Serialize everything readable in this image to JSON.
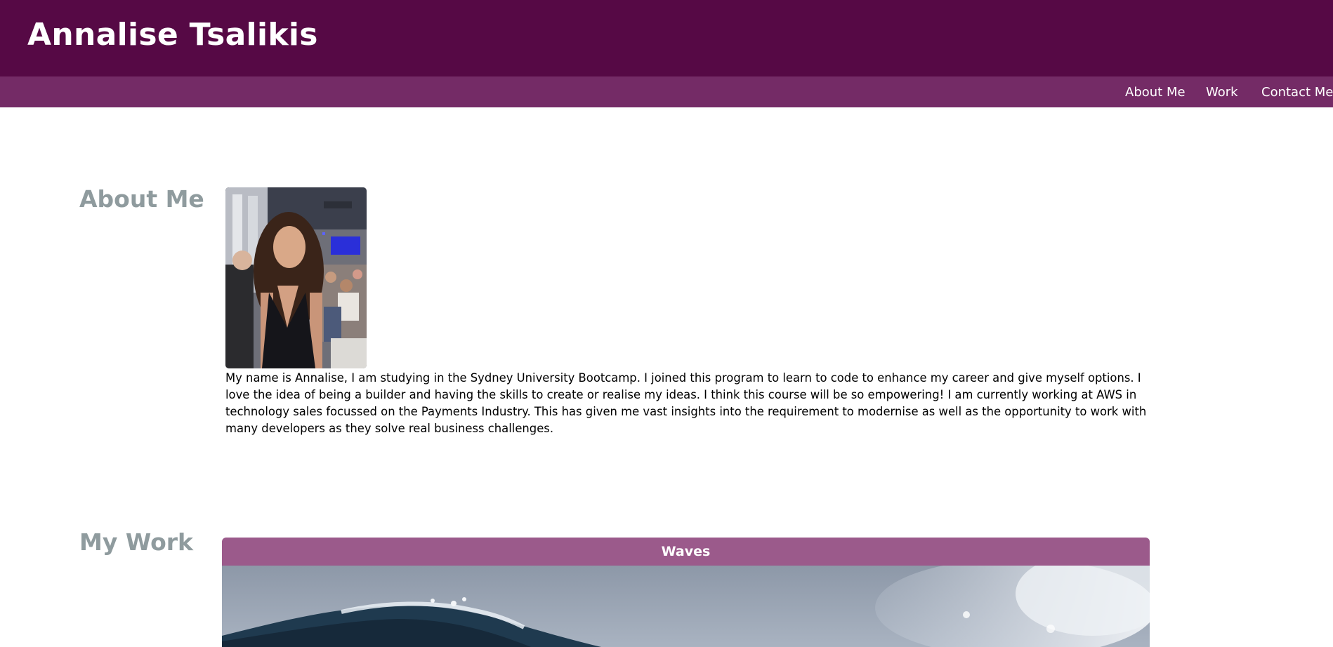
{
  "header": {
    "title": "Annalise Tsalikis"
  },
  "nav": {
    "items": [
      {
        "label": "About Me"
      },
      {
        "label": "Work"
      },
      {
        "label": "Contact Me"
      }
    ]
  },
  "about": {
    "heading": "About Me",
    "bio": "My name is Annalise, I am studying in the Sydney University Bootcamp. I joined this program to learn to code to enhance my career and give myself options. I love the idea of being a builder and having the skills to create or realise my ideas. I think this course will be so empowering! I am currently working at AWS in technology sales focussed on the Payments Industry. This has given me vast insights into the requirement to modernise as well as the opportunity to work with many developers as they solve real business challenges."
  },
  "work": {
    "heading": "My Work",
    "projects": [
      {
        "title": "Waves"
      }
    ]
  },
  "colors": {
    "header_bg": "#560945",
    "nav_bg": "#742b66",
    "heading_gray": "#8f9b9e",
    "card_header_bg": "#9b5a8b"
  }
}
